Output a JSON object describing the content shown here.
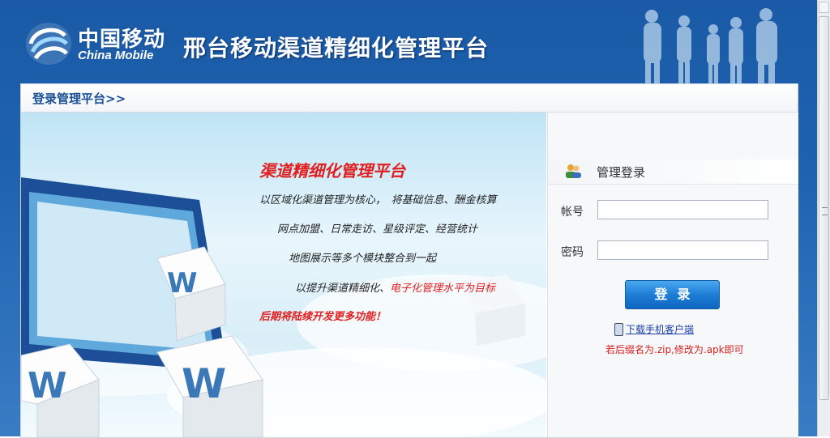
{
  "header": {
    "logo_cn": "中国移动",
    "logo_en": "China Mobile",
    "title": "邢台移动渠道精细化管理平台"
  },
  "breadcrumb": "登录管理平台>>",
  "promo": {
    "title": "渠道精细化管理平台",
    "line1": "以区域化渠道管理为核心，　将基础信息、酬金核算",
    "line2": "网点加盟、日常走访、星级评定、经营统计",
    "line3": "地图展示等多个模块整合到一起",
    "line4_prefix": "以提升渠道精细化、",
    "line4_red": "电子化管理水平为目标",
    "line5": "后期将陆续开发更多功能！"
  },
  "login": {
    "heading": "管理登录",
    "account_label": "帐号",
    "account_value": "",
    "password_label": "密码",
    "password_value": "",
    "submit_label": "登录",
    "download_link": "下载手机客户端",
    "note": "若后缀名为.zip,修改为.apk即可"
  },
  "colors": {
    "header_blue": "#1f63b0",
    "accent_red": "#e02020",
    "button_blue": "#1d7ed6",
    "link_blue": "#1a3fa8"
  }
}
